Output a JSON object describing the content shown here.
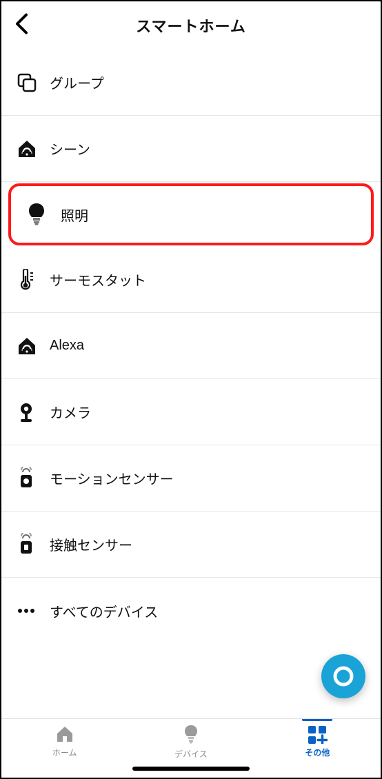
{
  "header": {
    "title": "スマートホーム"
  },
  "menu": [
    {
      "id": "groups",
      "label": "グループ",
      "icon": "groups"
    },
    {
      "id": "scenes",
      "label": "シーン",
      "icon": "scene"
    },
    {
      "id": "lights",
      "label": "照明",
      "icon": "bulb",
      "highlighted": true
    },
    {
      "id": "thermostat",
      "label": "サーモスタット",
      "icon": "thermo"
    },
    {
      "id": "alexa",
      "label": "Alexa",
      "icon": "alexa"
    },
    {
      "id": "camera",
      "label": "カメラ",
      "icon": "camera"
    },
    {
      "id": "motion",
      "label": "モーションセンサー",
      "icon": "motion"
    },
    {
      "id": "contact",
      "label": "接触センサー",
      "icon": "contact"
    },
    {
      "id": "all",
      "label": "すべてのデバイス",
      "icon": "more"
    }
  ],
  "bottom": [
    {
      "id": "home",
      "label": "ホーム"
    },
    {
      "id": "devices",
      "label": "デバイス"
    },
    {
      "id": "other",
      "label": "その他",
      "active": true
    }
  ],
  "fab": {
    "name": "alexa-voice"
  }
}
